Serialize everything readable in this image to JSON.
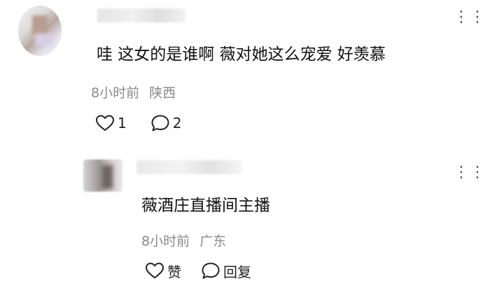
{
  "comment": {
    "text": "哇 这女的是谁啊 薇对她这么宠爱 好羡慕",
    "time": "8小时前",
    "location": "陕西",
    "like_count": "1",
    "reply_count": "2",
    "more_icon": "more-dots-icon"
  },
  "reply": {
    "text": "薇酒庄直播间主播",
    "time": "8小时前",
    "location": "广东",
    "like_label": "赞",
    "reply_label": "回复",
    "more_icon": "more-dots-icon"
  },
  "colors": {
    "text": "#111111",
    "meta": "#8a8a8a",
    "icon": "#222222"
  }
}
